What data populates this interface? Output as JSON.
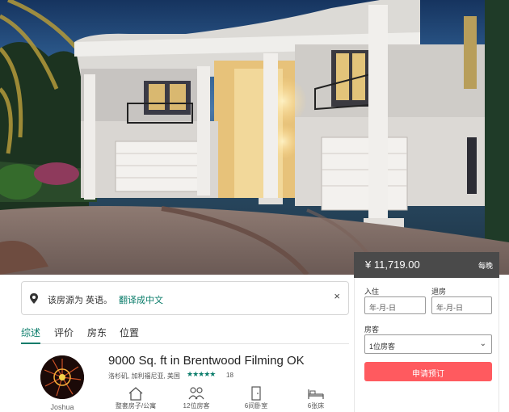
{
  "translation": {
    "notice": "该房源为 英语。",
    "link": "翻译成中文",
    "close": "×"
  },
  "tabs": [
    {
      "label": "综述"
    },
    {
      "label": "评价"
    },
    {
      "label": "房东"
    },
    {
      "label": "位置"
    }
  ],
  "listing": {
    "title": "9000 Sq. ft in Brentwood Filming OK",
    "location": "洛杉矶, 加利福尼亚, 美国",
    "stars": "★★★★★",
    "rating": 5,
    "reviews": "18",
    "host": "Joshua",
    "amenities": [
      {
        "label": "整套房子/公寓",
        "icon": "house-icon"
      },
      {
        "label": "12位房客",
        "icon": "guests-icon"
      },
      {
        "label": "6间卧室",
        "icon": "door-icon"
      },
      {
        "label": "6张床",
        "icon": "bed-icon"
      }
    ]
  },
  "booking": {
    "price": "¥ 11,719.00",
    "per": "每晚",
    "checkin_label": "入住",
    "checkout_label": "退房",
    "date_placeholder": "年-月-日",
    "guests_label": "房客",
    "guests_value": "1位房客",
    "book_button": "申请预订"
  },
  "colors": {
    "accent": "#0a7c6a",
    "book_button": "#ff5a5f",
    "price_bar": "#4a4a4a"
  }
}
